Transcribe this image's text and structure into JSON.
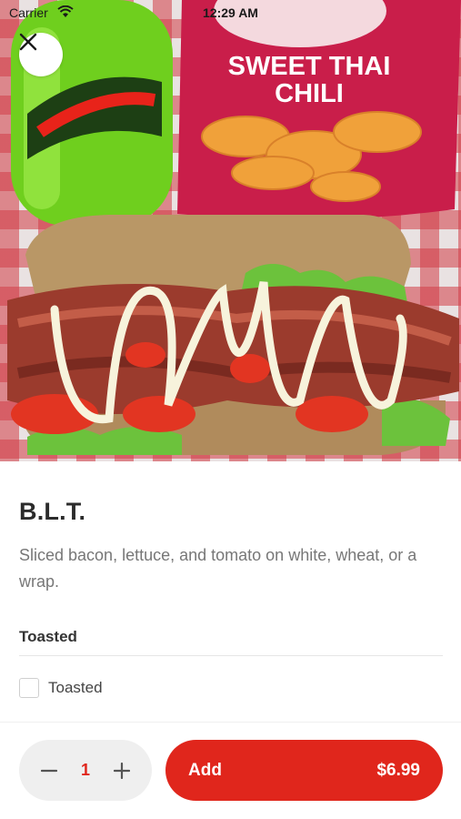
{
  "status_bar": {
    "carrier": "Carrier",
    "time": "12:29 AM"
  },
  "hero": {
    "photo_description_icon": "food-photo",
    "chips_bag_text_line1": "SWEET THAI",
    "chips_bag_text_line2": "CHILI"
  },
  "item": {
    "title": "B.L.T.",
    "description": "Sliced bacon, lettuce, and tomato on white, wheat, or a wrap."
  },
  "options_section": {
    "header": "Toasted",
    "options": [
      {
        "label": "Toasted",
        "checked": false
      }
    ]
  },
  "order": {
    "quantity": "1",
    "add_label": "Add",
    "price": "$6.99"
  },
  "colors": {
    "accent": "#e0261c",
    "stepper_bg": "#efefef"
  }
}
